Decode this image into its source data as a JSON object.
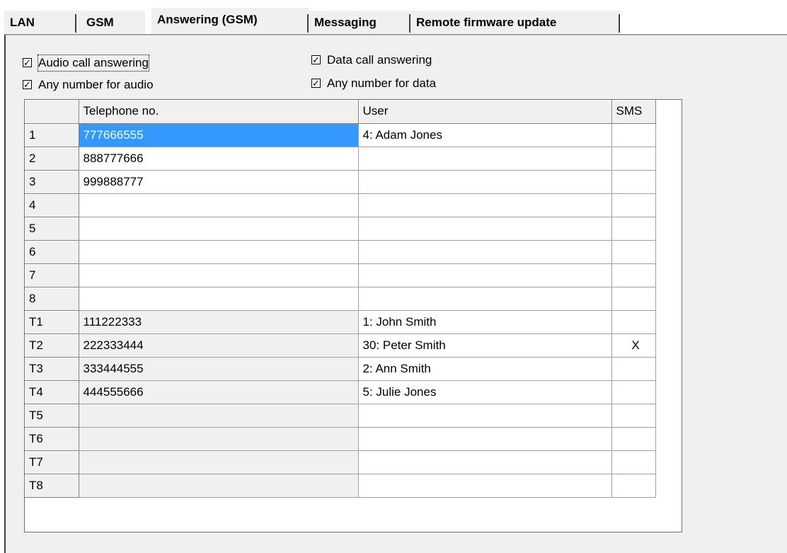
{
  "tabs": [
    {
      "label": "LAN",
      "active": false
    },
    {
      "label": "GSM",
      "active": false
    },
    {
      "label": "Answering (GSM)",
      "active": true
    },
    {
      "label": "Messaging",
      "active": false
    },
    {
      "label": "Remote firmware update",
      "active": false
    }
  ],
  "options": {
    "audio_call_answering": {
      "label": "Audio call answering",
      "checked": true
    },
    "any_number_for_audio": {
      "label": "Any number for audio",
      "checked": true
    },
    "data_call_answering": {
      "label": "Data call answering",
      "checked": true
    },
    "any_number_for_data": {
      "label": "Any number for data",
      "checked": true
    }
  },
  "grid": {
    "headers": [
      "",
      "Telephone no.",
      "User",
      "SMS"
    ],
    "rows": [
      {
        "id": "1",
        "phone": "777666555",
        "user": "4: Adam Jones",
        "sms": ""
      },
      {
        "id": "2",
        "phone": "888777666",
        "user": "",
        "sms": ""
      },
      {
        "id": "3",
        "phone": "999888777",
        "user": "",
        "sms": ""
      },
      {
        "id": "4",
        "phone": "",
        "user": "",
        "sms": ""
      },
      {
        "id": "5",
        "phone": "",
        "user": "",
        "sms": ""
      },
      {
        "id": "6",
        "phone": "",
        "user": "",
        "sms": ""
      },
      {
        "id": "7",
        "phone": "",
        "user": "",
        "sms": ""
      },
      {
        "id": "8",
        "phone": "",
        "user": "",
        "sms": ""
      },
      {
        "id": "T1",
        "phone": "111222333",
        "user": "1: John Smith",
        "sms": ""
      },
      {
        "id": "T2",
        "phone": "222333444",
        "user": "30: Peter Smith",
        "sms": "X"
      },
      {
        "id": "T3",
        "phone": "333444555",
        "user": "2: Ann Smith",
        "sms": ""
      },
      {
        "id": "T4",
        "phone": "444555666",
        "user": "5: Julie Jones",
        "sms": ""
      },
      {
        "id": "T5",
        "phone": "",
        "user": "",
        "sms": ""
      },
      {
        "id": "T6",
        "phone": "",
        "user": "",
        "sms": ""
      },
      {
        "id": "T7",
        "phone": "",
        "user": "",
        "sms": ""
      },
      {
        "id": "T8",
        "phone": "",
        "user": "",
        "sms": ""
      }
    ],
    "selected_row": 0,
    "check_mark": "✓"
  }
}
